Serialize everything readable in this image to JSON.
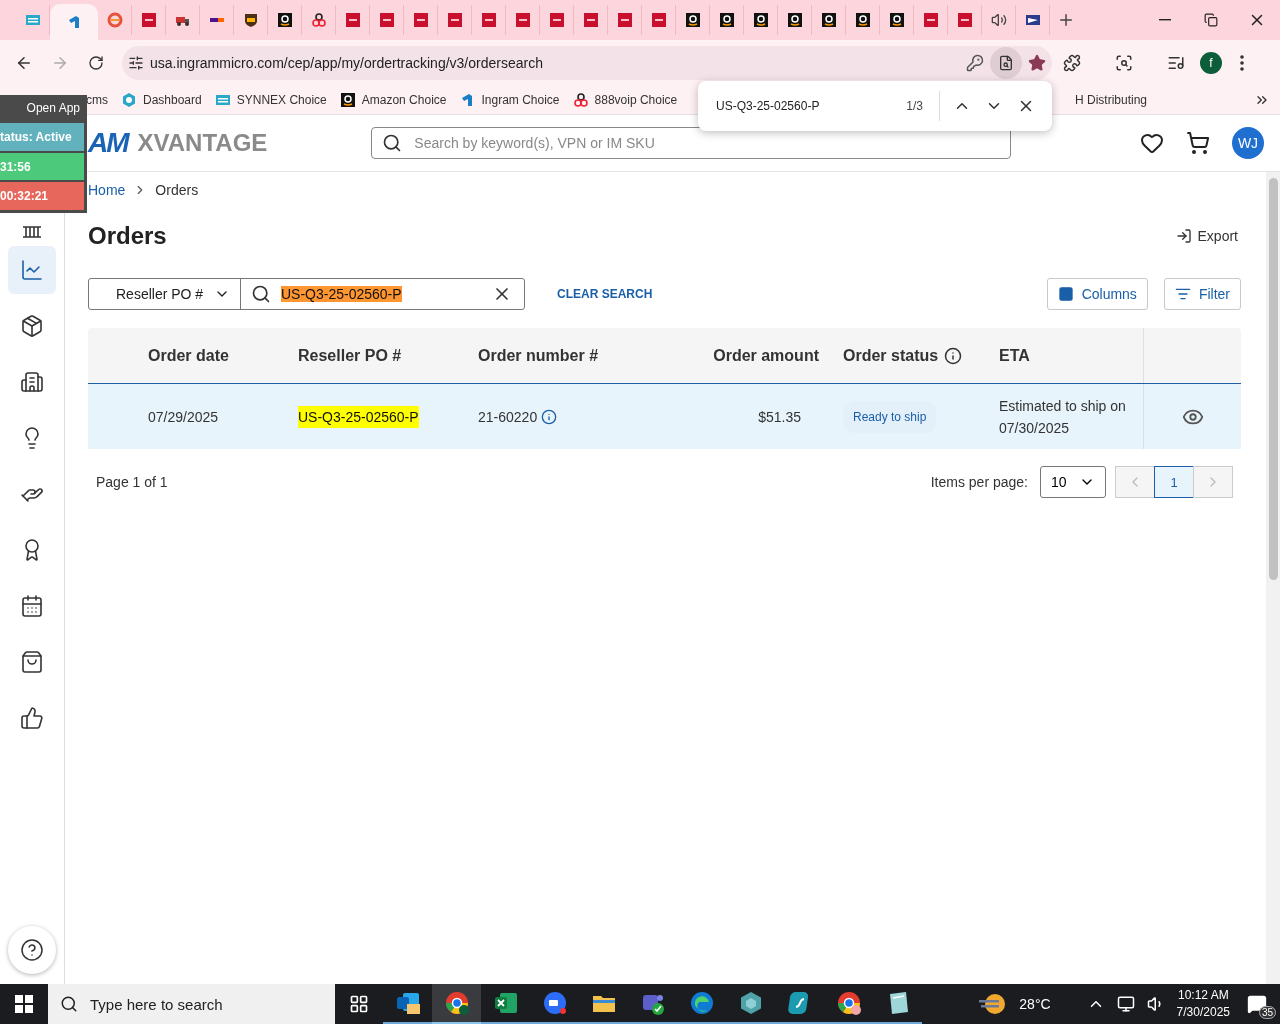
{
  "browser": {
    "tabs": [
      {
        "kind": "ec",
        "selected": false
      },
      {
        "kind": "ingram",
        "selected": true
      },
      {
        "kind": "swirl",
        "selected": false
      },
      {
        "kind": "dh",
        "selected": false
      },
      {
        "kind": "truck",
        "selected": false
      },
      {
        "kind": "fedex",
        "selected": false
      },
      {
        "kind": "ups",
        "selected": false
      },
      {
        "kind": "amazon",
        "selected": false
      },
      {
        "kind": "rings",
        "selected": false
      },
      {
        "kind": "dh",
        "selected": false
      },
      {
        "kind": "dh",
        "selected": false
      },
      {
        "kind": "dh",
        "selected": false
      },
      {
        "kind": "dh",
        "selected": false
      },
      {
        "kind": "dh",
        "selected": false
      },
      {
        "kind": "dh",
        "selected": false
      },
      {
        "kind": "dh",
        "selected": false
      },
      {
        "kind": "dh",
        "selected": false
      },
      {
        "kind": "dh",
        "selected": false
      },
      {
        "kind": "dh",
        "selected": false
      },
      {
        "kind": "amazon",
        "selected": false
      },
      {
        "kind": "amazon",
        "selected": false
      },
      {
        "kind": "amazon",
        "selected": false
      },
      {
        "kind": "amazon",
        "selected": false
      },
      {
        "kind": "amazon",
        "selected": false
      },
      {
        "kind": "amazon",
        "selected": false
      },
      {
        "kind": "amazon",
        "selected": false
      },
      {
        "kind": "dh",
        "selected": false
      },
      {
        "kind": "dh",
        "selected": false
      },
      {
        "kind": "sound",
        "selected": false
      },
      {
        "kind": "usps",
        "selected": false
      }
    ],
    "url": "usa.ingrammicro.com/cep/app/my/ordertracking/v3/ordersearch",
    "profile": "f",
    "bookmarks": [
      {
        "kind": "none",
        "label": "cms"
      },
      {
        "kind": "dashboard",
        "label": "Dashboard"
      },
      {
        "kind": "ec",
        "label": "SYNNEX Choice"
      },
      {
        "kind": "amazon",
        "label": "Amazon Choice"
      },
      {
        "kind": "ingram",
        "label": "Ingram Choice"
      },
      {
        "kind": "rings",
        "label": "888voip Choice"
      }
    ],
    "bookmarks_right": [
      {
        "label": "H Distributing"
      }
    ],
    "find_bar": {
      "query": "US-Q3-25-02560-P",
      "count": "1/3"
    }
  },
  "timer_widget": {
    "open_label": "Open App",
    "status": "tatus: Active",
    "elapsed": "31:56",
    "total": "00:32:21"
  },
  "header": {
    "logo_visible": "AM",
    "logo_product": "XVANTAGE",
    "search_placeholder": "Search by keyword(s), VPN or IM SKU",
    "avatar": "WJ"
  },
  "sidebar": {
    "items": [
      {
        "kind": "home",
        "selected": false
      },
      {
        "kind": "chart",
        "selected": true
      },
      {
        "kind": "box",
        "selected": false
      },
      {
        "kind": "building",
        "selected": false
      },
      {
        "kind": "bulb",
        "selected": false
      },
      {
        "kind": "hand",
        "selected": false
      },
      {
        "kind": "award",
        "selected": false
      },
      {
        "kind": "calendar",
        "selected": false
      },
      {
        "kind": "bag",
        "selected": false
      },
      {
        "kind": "thumb",
        "selected": false
      }
    ]
  },
  "breadcrumb": [
    {
      "label": "Home",
      "link": true
    },
    {
      "label": "Orders",
      "link": false
    }
  ],
  "title": "Orders",
  "export_label": "Export",
  "search": {
    "field": "Reseller PO #",
    "value": "US-Q3-25-02560-P",
    "highlighted": true,
    "clear_label": "CLEAR SEARCH"
  },
  "columns_label": "Columns",
  "filter_label": "Filter",
  "table": {
    "columns": [
      {
        "label": "Order date",
        "info": false
      },
      {
        "label": "Reseller PO #",
        "info": false
      },
      {
        "label": "Order number #",
        "info": false
      },
      {
        "label": "Order amount",
        "info": false
      },
      {
        "label": "Order status",
        "info": true
      },
      {
        "label": "ETA",
        "info": false
      }
    ],
    "rows": [
      {
        "selected": true,
        "date": "07/29/2025",
        "po": "US-Q3-25-02560-P",
        "po_highlighted": true,
        "order_number": "21-60220",
        "amount": "$51.35",
        "status": "Ready to ship",
        "eta": "Estimated to ship on 07/30/2025"
      }
    ]
  },
  "pagination": {
    "summary": "Page 1 of 1",
    "per_page_label": "Items per page:",
    "per_page": "10",
    "pages": [
      {
        "label": "1",
        "selected": true
      }
    ]
  },
  "taskbar": {
    "search_placeholder": "Type here to search",
    "apps": [
      {
        "kind": "outlook",
        "selected": false
      },
      {
        "kind": "chrome",
        "selected": true
      },
      {
        "kind": "excel",
        "selected": false
      },
      {
        "kind": "zoom",
        "selected": false
      },
      {
        "kind": "folder",
        "selected": false
      },
      {
        "kind": "teams",
        "selected": false
      },
      {
        "kind": "edge",
        "selected": false
      },
      {
        "kind": "hex",
        "selected": false
      },
      {
        "kind": "surf",
        "selected": false
      },
      {
        "kind": "chrome2",
        "selected": false
      },
      {
        "kind": "notes",
        "selected": false
      }
    ],
    "temperature": "28°C",
    "time": "10:12 AM",
    "date": "7/30/2025",
    "notifications": "35"
  }
}
